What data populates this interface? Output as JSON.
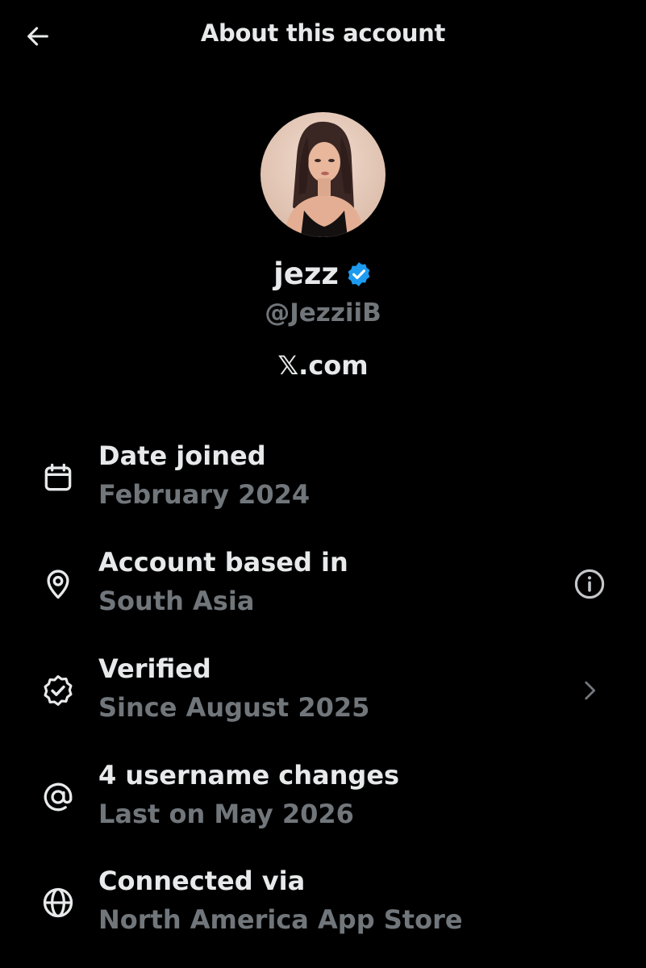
{
  "header": {
    "title": "About this account",
    "back_icon": "arrow-left-icon"
  },
  "profile": {
    "display_name": "jezz",
    "handle": "@JezziiB",
    "domain": "𝕏.com",
    "verified_color": "#1d9bf0"
  },
  "rows": [
    {
      "icon": "calendar-icon",
      "title": "Date joined",
      "subtitle": "February 2024"
    },
    {
      "icon": "location-pin-icon",
      "title": "Account based in",
      "subtitle": "South Asia",
      "action_icon": "info-icon"
    },
    {
      "icon": "verified-check-icon",
      "title": "Verified",
      "subtitle": "Since August 2025",
      "action_icon": "chevron-right-icon"
    },
    {
      "icon": "at-sign-icon",
      "title": "4 username changes",
      "subtitle": "Last on May 2026"
    },
    {
      "icon": "globe-icon",
      "title": "Connected via",
      "subtitle": "North America App Store"
    }
  ],
  "colors": {
    "background": "#000000",
    "primary_text": "#e7e9ea",
    "secondary_text": "#71767b",
    "accent": "#1d9bf0"
  }
}
